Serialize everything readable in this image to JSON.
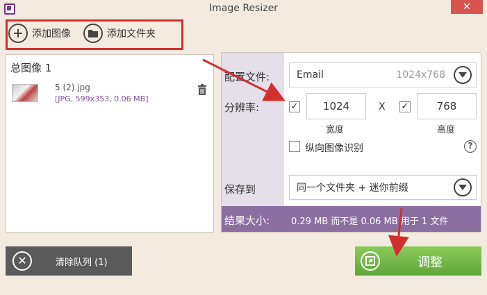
{
  "window": {
    "title": "Image Resizer",
    "close_glyph": "✕"
  },
  "toolbar": {
    "add_image_label": "添加图像",
    "add_folder_label": "添加文件夹"
  },
  "queue": {
    "title": "总图像 1",
    "items": [
      {
        "name": "5 (2).jpg",
        "meta": "[JPG, 599x353, 0.06 MB]"
      }
    ]
  },
  "settings": {
    "profile_label": "配置文件:",
    "profile_value": "Email",
    "profile_hint": "1024x768",
    "resolution_label": "分辨率:",
    "width_checked": "✓",
    "width_value": "1024",
    "separator": "X",
    "height_checked": "✓",
    "height_value": "768",
    "width_label": "宽度",
    "height_label": "高度",
    "portrait_label": "纵向图像识别",
    "help_glyph": "?",
    "save_label": "保存到",
    "save_value": "同一个文件夹 + 迷你前缀",
    "result_label": "结果大小:",
    "result_value": "0.29 MB 而不是 0.06 MB 用于 1 文件"
  },
  "actions": {
    "clear_label": "清除队列 (1)",
    "clear_glyph": "✕",
    "resize_label": "调整"
  },
  "colors": {
    "accent_purple": "#8a6fa0",
    "resize_green": "#6cb545",
    "annotation_red": "#d32f2f"
  }
}
